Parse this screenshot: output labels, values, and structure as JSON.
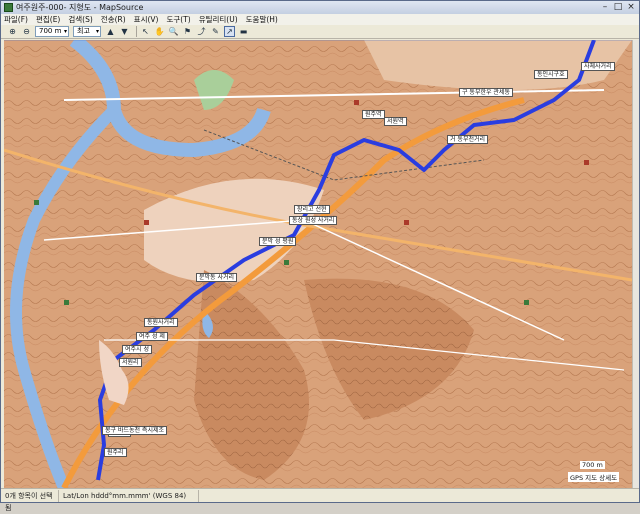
{
  "window": {
    "title": "여주원주-000- 지형도 - MapSource",
    "minimize": "–",
    "maximize": "□",
    "close": "×"
  },
  "menu": [
    "파일(F)",
    "편집(E)",
    "검색(S)",
    "전송(R)",
    "표시(V)",
    "도구(T)",
    "유틸리티(U)",
    "도움말(H)"
  ],
  "toolbar": {
    "zoom_value": "700 m",
    "detail_value": "최고"
  },
  "map": {
    "labels": [
      "동인시구호",
      "사체사거리",
      "구 동부한우 관세동",
      "원주역",
      "서원역",
      "거 동부천거리",
      "장리고 선현",
      "동상 원성 사거리",
      "문막 성 평원",
      "문막동 사거리",
      "동원사거리",
      "여주 성 제",
      "여주시 성",
      "서원리",
      "여주역",
      "봉구 바드농천 측시제조",
      "원주리"
    ],
    "scale_text": "700 m",
    "detail_text": "GPS 지도 상세도"
  },
  "status": {
    "selection": "0개 항목이 선택됨",
    "format": "Lat/Lon hddd°mm.mmm' (WGS 84)"
  }
}
